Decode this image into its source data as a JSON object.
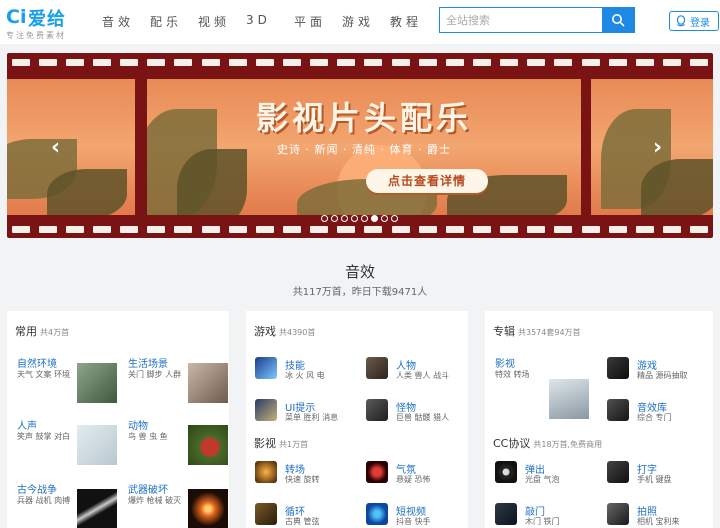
{
  "brand": {
    "mark": "Ci",
    "name": "爱给",
    "slogan": "专注免费素材"
  },
  "nav": [
    "音效",
    "配乐",
    "视频",
    "3D",
    "平面",
    "游戏",
    "教程"
  ],
  "search": {
    "placeholder": "全站搜索"
  },
  "banner": {
    "title": "影视片头配乐",
    "tags": "史诗 · 新闻 · 清纯 · 体育 · 爵士",
    "cta": "点击查看详情",
    "slide_count": 8,
    "active_slide": 6
  },
  "section": {
    "title": "音效",
    "subtitle": "共117万首，昨日下载9471人"
  },
  "col1": {
    "head": "常用",
    "count": "共4万首",
    "items": [
      {
        "name": "自然环境",
        "tags": "天气 文案 环境"
      },
      {
        "name": "生活场景",
        "tags": "关门 脚步 人群"
      },
      {
        "name": "人声",
        "tags": "笑声 鼓掌 对白"
      },
      {
        "name": "动物",
        "tags": "鸟 兽 虫 鱼"
      },
      {
        "name": "古今战争",
        "tags": "兵器 战机 肉搏"
      },
      {
        "name": "武器破坏",
        "tags": "爆炸 枪械 破灭"
      }
    ]
  },
  "col2": {
    "head1": "游戏",
    "count1": "共4390首",
    "game_items": [
      {
        "name": "技能",
        "tags": "冰 火 风 电"
      },
      {
        "name": "人物",
        "tags": "人类 兽人 战斗"
      },
      {
        "name": "UI提示",
        "tags": "菜单 胜利 消息"
      },
      {
        "name": "怪物",
        "tags": "巨兽 骷髅 猎人"
      }
    ],
    "head2": "影视",
    "count2": "共1万首",
    "film_items": [
      {
        "name": "转场",
        "tags": "快速 旋转"
      },
      {
        "name": "气氛",
        "tags": "悬疑 恐怖"
      },
      {
        "name": "循环",
        "tags": "古典 管弦"
      },
      {
        "name": "短视频",
        "tags": "抖音 快手"
      }
    ]
  },
  "col3": {
    "head1": "专辑",
    "count1": "共3574套94万首",
    "album_items": [
      {
        "name": "影视",
        "tags": "特效 转场"
      },
      {
        "name": "游戏",
        "tags": "精品 源码抽取"
      },
      {
        "name": "音效库",
        "tags": "综合 专门"
      }
    ],
    "head2": "CC协议",
    "count2": "共18万首,免费商用",
    "cc_items": [
      {
        "name": "弹出",
        "tags": "光盘 气泡"
      },
      {
        "name": "打字",
        "tags": "手机 键盘"
      },
      {
        "name": "敲门",
        "tags": "木门 铁门"
      },
      {
        "name": "拍照",
        "tags": "相机 宝利来"
      }
    ]
  }
}
